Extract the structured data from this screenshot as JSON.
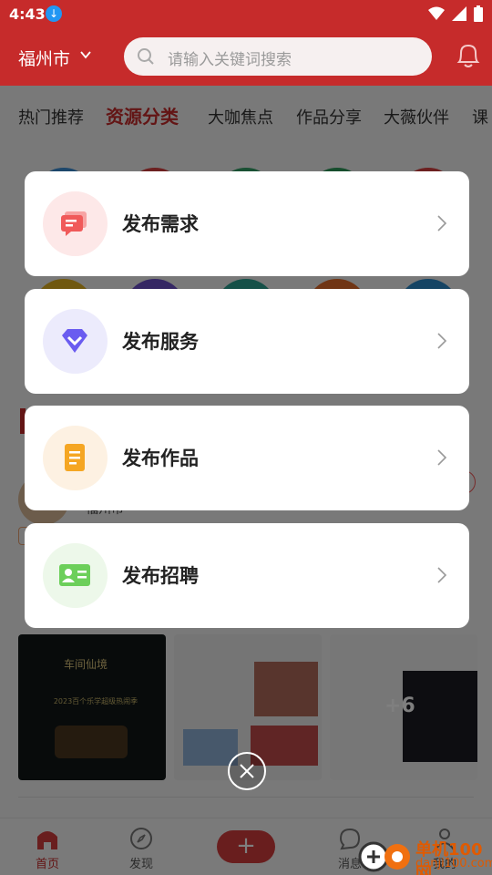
{
  "status_bar": {
    "time": "4:43"
  },
  "header": {
    "city": "福州市",
    "search_placeholder": "请输入关键词搜索"
  },
  "tabs": [
    {
      "label": "热门推荐",
      "active": false
    },
    {
      "label": "资源分类",
      "active": true
    },
    {
      "label": "大咖焦点",
      "active": false
    },
    {
      "label": "作品分享",
      "active": false
    },
    {
      "label": "大薇伙伴",
      "active": false
    },
    {
      "label": "课",
      "active": false
    }
  ],
  "feed": {
    "author_city": "福州市",
    "more_images_count": "+6",
    "thumb1_title": "车间仙境",
    "thumb1_subtitle": "2023百个乐学超级热闹季"
  },
  "publish_menu": {
    "items": [
      {
        "label": "发布需求",
        "icon": "message-icon",
        "color": "#f05a5a",
        "bg": "#fde8e8"
      },
      {
        "label": "发布服务",
        "icon": "diamond-icon",
        "color": "#6a5cf0",
        "bg": "#ecebfc"
      },
      {
        "label": "发布作品",
        "icon": "document-icon",
        "color": "#f5a623",
        "bg": "#fdf1e2"
      },
      {
        "label": "发布招聘",
        "icon": "id-card-icon",
        "color": "#6ccf5a",
        "bg": "#edf8ea"
      }
    ]
  },
  "bottom_nav": {
    "items": [
      {
        "label": "首页",
        "active": true
      },
      {
        "label": "发现",
        "active": false
      },
      {
        "label": "消息",
        "active": false
      },
      {
        "label": "我的",
        "active": false
      }
    ],
    "post_label": "+"
  },
  "watermark": {
    "brand": "单机100网",
    "url": "danji100.com"
  },
  "colors": {
    "brand_red": "#c62b2b",
    "overlay": "rgba(0,0,0,0.5)"
  }
}
